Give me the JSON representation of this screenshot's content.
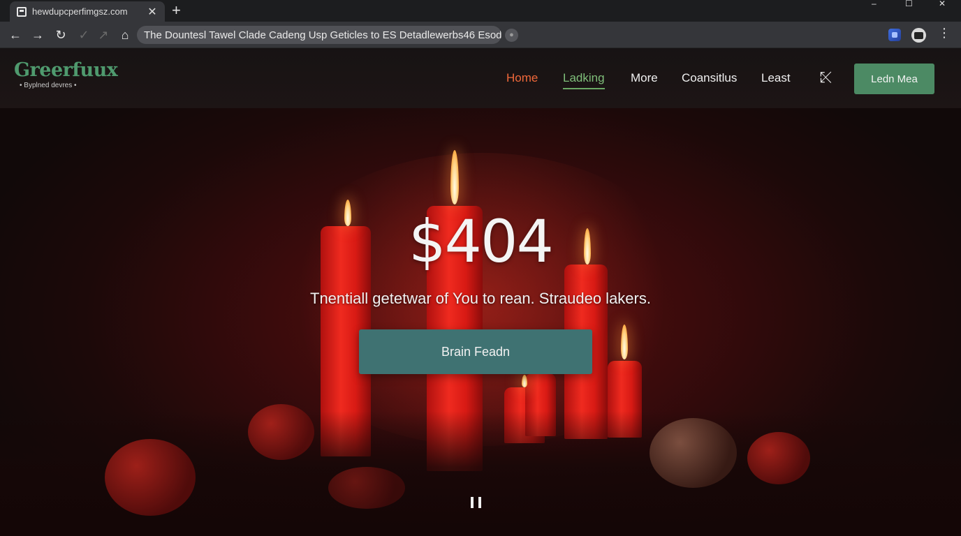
{
  "browser": {
    "tab_title": "hewdupcperfimgsz.com",
    "tab_close": "✕",
    "new_tab": "+",
    "window_controls": {
      "minimize": "–",
      "maximize": "☐",
      "close": "✕"
    },
    "nav": {
      "back": "←",
      "forward": "→",
      "reload": "↻",
      "home": "⌂"
    },
    "address": "The Dountesl Tawel Clade Cadeng Usp Geticles to ES Detadlewerbs46 Esod",
    "menu": "⋮",
    "icons": [
      "back-icon",
      "forward-icon",
      "reload-icon",
      "home-icon",
      "extension-icon",
      "profile-icon",
      "menu-icon"
    ]
  },
  "site": {
    "logo_name": "Greerfuux",
    "logo_tagline": "• Byplned devres •",
    "nav": [
      {
        "label": "Home"
      },
      {
        "label": "Ladking"
      },
      {
        "label": "More"
      },
      {
        "label": "Coansitlus"
      },
      {
        "label": "Least"
      }
    ],
    "nav_icon": "⤪",
    "cta": "Ledn Mea",
    "colors": {
      "accent_green": "#4c8a64",
      "nav_active": "#f0683a",
      "nav_current": "#7fbf7a",
      "hero_button": "#3f7272"
    }
  },
  "hero": {
    "title": "$404",
    "subtitle": "Tnentiall getetwar of You to rean. Straudeo lakers.",
    "button": "Brain Feadn"
  }
}
